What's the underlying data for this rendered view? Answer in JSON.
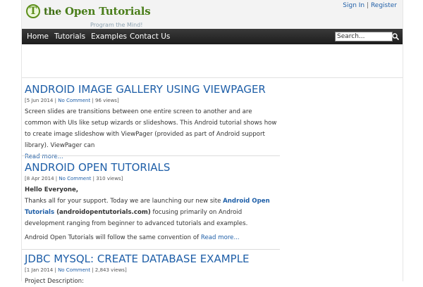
{
  "header": {
    "logo_mark": "T",
    "logo_the": "the",
    "logo_name": "Open Tutorials",
    "tagline": "Program the Mind!",
    "sign_in": "Sign In",
    "separator": "|",
    "register": "Register"
  },
  "nav": {
    "items": [
      "Home",
      "Tutorials",
      "Examples",
      "Contact Us"
    ],
    "search_value": "Search..."
  },
  "posts": [
    {
      "title": "Android Image Gallery using ViewPager",
      "meta_date": "[5 Jun 2014 | ",
      "meta_comments": "No Comment",
      "meta_views": " | 96 views]",
      "body": "Screen slides are transitions between one entire screen to another and are common with UIs like setup wizards or slideshows. This Android tutorial shows how to create image slideshow with ViewPager (provided as part of Android support library). ViewPager can",
      "read_more": "Read more..."
    },
    {
      "title": "Android Open Tutorials",
      "meta_date": "[8 Apr 2014 | ",
      "meta_comments": "No Comment",
      "meta_views": " | 310 views]",
      "greeting": "Hello Everyone,",
      "body_a": "Thanks all for your support. Today we are launching our new site ",
      "site_name": "Android Open Tutorials",
      "body_b": " (androidopentutorials.com)",
      "body_c": " focusing primarily on Android development ranging from beginner to advanced tutorials and examples.",
      "body_d": "Android Open Tutorials will follow the same convention of ",
      "read_more": "Read more..."
    },
    {
      "title": "JDBC MySQL: Create Database Example",
      "meta_date": "[1 Jan 2014 | ",
      "meta_comments": "No Comment",
      "meta_views": " | 2,843 views]",
      "body": "Project Description:"
    }
  ],
  "colors": {
    "link": "#1f5fa8",
    "nav_bg": "#222222",
    "logo_green": "#4a7e1a"
  }
}
